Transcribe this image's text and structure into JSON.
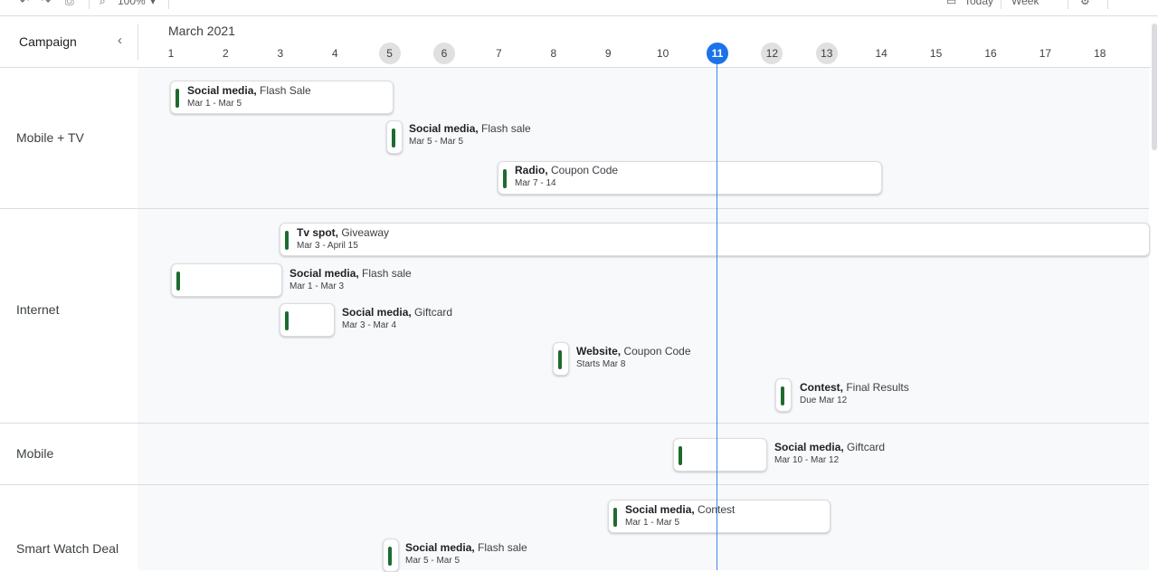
{
  "toolbar": {
    "zoom": "100%",
    "today_label": "Today",
    "view_label": "Week"
  },
  "sidebar": {
    "header": "Campaign",
    "collapse_icon": "chevron-left-icon"
  },
  "timeline": {
    "month": "March 2021",
    "today": 11,
    "days": [
      1,
      2,
      3,
      4,
      5,
      6,
      7,
      8,
      9,
      10,
      11,
      12,
      13,
      14,
      15,
      16,
      17,
      18
    ],
    "weekend_days": [
      5,
      6,
      12,
      13
    ]
  },
  "groups": [
    {
      "name": "Mobile + TV",
      "events": [
        {
          "title": "Social media,",
          "sub": " Flash Sale",
          "dates": "Mar 1 - Mar 5"
        },
        {
          "title": "Social media,",
          "sub": " Flash sale",
          "dates": "Mar 5 - Mar 5"
        },
        {
          "title": "Radio,",
          "sub": " Coupon Code",
          "dates": "Mar 7 - 14"
        }
      ]
    },
    {
      "name": "Internet",
      "events": [
        {
          "title": "Tv spot,",
          "sub": " Giveaway",
          "dates": "Mar 3 - April 15"
        },
        {
          "title": "Social media,",
          "sub": " Flash sale",
          "dates": "Mar 1 - Mar 3"
        },
        {
          "title": "Social media,",
          "sub": " Giftcard",
          "dates": "Mar 3 - Mar 4"
        },
        {
          "title": "Website,",
          "sub": " Coupon Code",
          "dates": "Starts Mar 8"
        },
        {
          "title": "Contest,",
          "sub": " Final Results",
          "dates": "Due Mar 12"
        }
      ]
    },
    {
      "name": "Mobile",
      "events": [
        {
          "title": "Social media,",
          "sub": " Giftcard",
          "dates": "Mar 10 - Mar 12"
        }
      ]
    },
    {
      "name": "Smart Watch Deal",
      "events": [
        {
          "title": "Social media,",
          "sub": " Contest",
          "dates": "Mar 1 - Mar 5"
        },
        {
          "title": "Social media,",
          "sub": " Flash sale",
          "dates": "Mar 5 - Mar 5"
        }
      ]
    }
  ]
}
